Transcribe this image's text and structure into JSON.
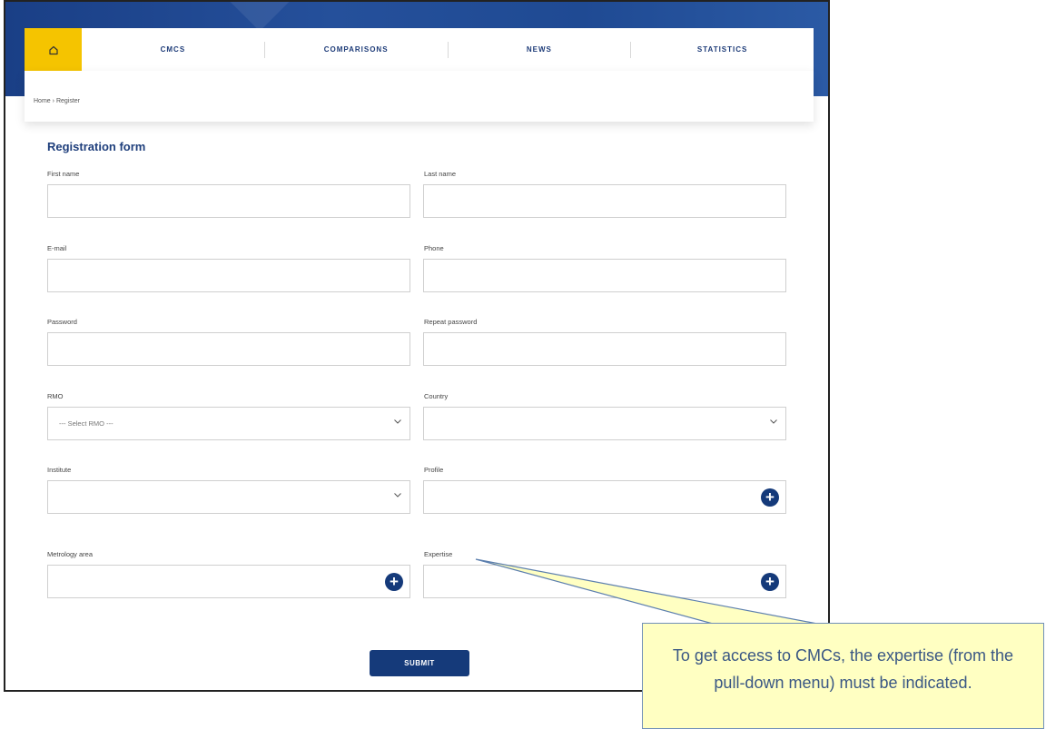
{
  "nav": {
    "items": [
      "CMCS",
      "COMPARISONS",
      "NEWS",
      "STATISTICS"
    ]
  },
  "breadcrumb": {
    "home": "Home",
    "separator": "›",
    "current": "Register"
  },
  "form": {
    "title": "Registration form",
    "first_name_label": "First name",
    "last_name_label": "Last name",
    "email_label": "E-mail",
    "phone_label": "Phone",
    "password_label": "Password",
    "repeat_password_label": "Repeat password",
    "rmo_label": "RMO",
    "rmo_placeholder": "--- Select RMO ---",
    "country_label": "Country",
    "institute_label": "Institute",
    "profile_label": "Profile",
    "metrology_label": "Metrology area",
    "expertise_label": "Expertise",
    "submit_label": "SUBMIT"
  },
  "callout": {
    "text": "To get access to CMCs, the expertise (from the pull-down menu) must be indicated."
  },
  "colors": {
    "nav_blue": "#1d3b78",
    "home_yellow": "#f5c400",
    "button_blue": "#153a7a",
    "callout_bg": "#ffffc2"
  }
}
